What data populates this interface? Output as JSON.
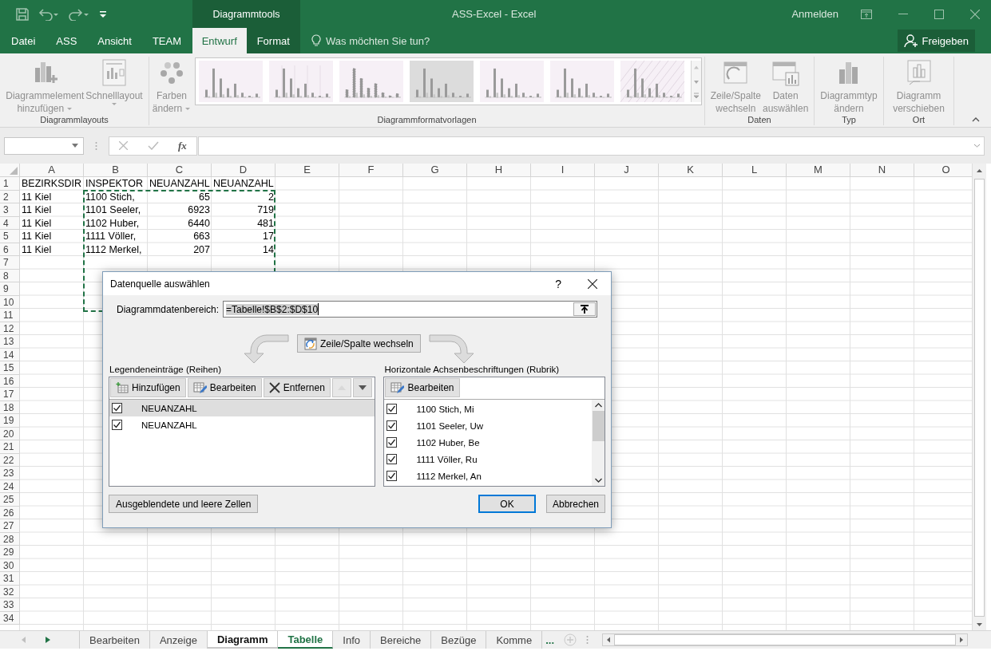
{
  "titlebar": {
    "context_header": "Diagrammtools",
    "title": "ASS-Excel - Excel",
    "sign_in": "Anmelden"
  },
  "tabs": [
    {
      "label": "Datei",
      "kind": "main",
      "selected": false
    },
    {
      "label": "ASS",
      "kind": "main",
      "selected": false
    },
    {
      "label": "Ansicht",
      "kind": "main",
      "selected": false
    },
    {
      "label": "TEAM",
      "kind": "main",
      "selected": false
    },
    {
      "label": "Entwurf",
      "kind": "context",
      "selected": true
    },
    {
      "label": "Format",
      "kind": "context",
      "selected": false
    }
  ],
  "tell_me": "Was möchten Sie tun?",
  "share_button": "Freigeben",
  "ribbon": {
    "groups": [
      {
        "label": "Diagrammlayouts",
        "items": [
          {
            "kind": "element",
            "lines": [
              "Diagrammelement",
              "hinzufügen"
            ],
            "dropdown": true
          },
          {
            "kind": "layout",
            "lines": [
              "Schnelllayout"
            ],
            "dropdown": true
          }
        ]
      },
      {
        "label": "Diagrammformatvorlagen",
        "items": [
          {
            "kind": "colors",
            "lines": [
              "Farben",
              "ändern"
            ],
            "dropdown": true
          },
          {
            "kind": "gallery",
            "styles": [
              {
                "kind": "plain"
              },
              {
                "kind": "grid"
              },
              {
                "kind": "dashed"
              },
              {
                "kind": "shaded"
              },
              {
                "kind": "plain"
              },
              {
                "kind": "plain"
              },
              {
                "kind": "hatched"
              }
            ]
          }
        ]
      },
      {
        "label": "Daten",
        "items": [
          {
            "kind": "switch",
            "lines": [
              "Zeile/Spalte",
              "wechseln"
            ],
            "dropdown": false
          },
          {
            "kind": "data",
            "lines": [
              "Daten",
              "auswählen"
            ],
            "dropdown": false
          }
        ]
      },
      {
        "label": "Typ",
        "items": [
          {
            "kind": "type",
            "lines": [
              "Diagrammtyp",
              "ändern"
            ],
            "dropdown": false
          }
        ]
      },
      {
        "label": "Ort",
        "items": [
          {
            "kind": "move",
            "lines": [
              "Diagramm",
              "verschieben"
            ],
            "dropdown": false
          }
        ]
      }
    ]
  },
  "formula_bar": {
    "fx": "fx"
  },
  "sheet": {
    "columns": [
      "A",
      "B",
      "C",
      "D",
      "E",
      "F",
      "G",
      "H",
      "I",
      "J",
      "K",
      "L",
      "M",
      "N",
      "O"
    ],
    "rows": [
      {
        "number": "1",
        "cells": [
          {
            "text": "BEZIRKSDIR",
            "kind": "text"
          },
          {
            "text": "INSPEKTOR",
            "kind": "text"
          },
          {
            "text": "NEUANZAHL",
            "kind": "text"
          },
          {
            "text": "NEUANZAHL",
            "kind": "text"
          }
        ]
      },
      {
        "number": "2",
        "cells": [
          {
            "text": "11 Kiel",
            "kind": "text"
          },
          {
            "text": "1100 Stich,",
            "kind": "text"
          },
          {
            "text": "65",
            "kind": "number"
          },
          {
            "text": "2",
            "kind": "number"
          }
        ]
      },
      {
        "number": "3",
        "cells": [
          {
            "text": "11 Kiel",
            "kind": "text"
          },
          {
            "text": "1101 Seeler,",
            "kind": "text"
          },
          {
            "text": "6923",
            "kind": "number"
          },
          {
            "text": "719",
            "kind": "number"
          }
        ]
      },
      {
        "number": "4",
        "cells": [
          {
            "text": "11 Kiel",
            "kind": "text"
          },
          {
            "text": "1102 Huber,",
            "kind": "text"
          },
          {
            "text": "6440",
            "kind": "number"
          },
          {
            "text": "481",
            "kind": "number"
          }
        ]
      },
      {
        "number": "5",
        "cells": [
          {
            "text": "11 Kiel",
            "kind": "text"
          },
          {
            "text": "1111 Völler,",
            "kind": "text"
          },
          {
            "text": "663",
            "kind": "number"
          },
          {
            "text": "17",
            "kind": "number"
          }
        ]
      },
      {
        "number": "6",
        "cells": [
          {
            "text": "11 Kiel",
            "kind": "text"
          },
          {
            "text": "1112 Merkel,",
            "kind": "text"
          },
          {
            "text": "207",
            "kind": "number"
          },
          {
            "text": "14",
            "kind": "number"
          }
        ]
      },
      {
        "number": "7"
      },
      {
        "number": "8"
      },
      {
        "number": "9"
      },
      {
        "number": "10"
      },
      {
        "number": "11"
      },
      {
        "number": "12"
      },
      {
        "number": "13"
      },
      {
        "number": "14"
      },
      {
        "number": "15"
      },
      {
        "number": "16"
      },
      {
        "number": "17"
      },
      {
        "number": "18"
      },
      {
        "number": "19"
      },
      {
        "number": "20"
      },
      {
        "number": "21"
      },
      {
        "number": "22"
      },
      {
        "number": "23"
      },
      {
        "number": "24"
      },
      {
        "number": "25"
      },
      {
        "number": "26"
      },
      {
        "number": "27"
      },
      {
        "number": "28"
      },
      {
        "number": "29"
      },
      {
        "number": "30"
      },
      {
        "number": "31"
      },
      {
        "number": "32"
      },
      {
        "number": "33"
      },
      {
        "number": "34"
      }
    ]
  },
  "sheet_tabs": [
    {
      "label": "Bearbeiten",
      "selected": false,
      "grouped": false
    },
    {
      "label": "Anzeige",
      "selected": false,
      "grouped": false
    },
    {
      "label": "Diagramm",
      "selected": false,
      "grouped": true
    },
    {
      "label": "Tabelle",
      "selected": true,
      "grouped": true
    },
    {
      "label": "Info",
      "selected": false,
      "grouped": false
    },
    {
      "label": "Bereiche",
      "selected": false,
      "grouped": false
    },
    {
      "label": "Bezüge",
      "selected": false,
      "grouped": false
    },
    {
      "label": "Komme",
      "selected": false,
      "grouped": false
    }
  ],
  "more_tabs": "...",
  "dialog": {
    "title": "Datenquelle auswählen",
    "help": "?",
    "range": {
      "label": "Diagrammdatenbereich:",
      "value": "=Tabelle!$B$2:$D$10",
      "text_selected": true
    },
    "switch_button": "Zeile/Spalte wechseln",
    "legend": {
      "title": "Legendeneinträge (Reihen)",
      "buttons": [
        {
          "kind": "add",
          "label": "Hinzufügen",
          "disabled": false
        },
        {
          "kind": "edit",
          "label": "Bearbeiten",
          "disabled": false
        },
        {
          "kind": "remove",
          "label": "Entfernen",
          "disabled": false
        },
        {
          "kind": "up",
          "disabled": true
        },
        {
          "kind": "down",
          "disabled": false
        }
      ],
      "series": [
        {
          "name": "NEUANZAHL",
          "checked": true,
          "selected": true
        },
        {
          "name": "NEUANZAHL",
          "checked": true,
          "selected": false
        }
      ]
    },
    "axis": {
      "title": "Horizontale Achsenbeschriftungen (Rubrik)",
      "buttons": [
        {
          "kind": "edit",
          "label": "Bearbeiten",
          "disabled": false
        }
      ],
      "categories": [
        {
          "name": "1100 Stich, Mi",
          "checked": true,
          "selected": false
        },
        {
          "name": "1101 Seeler, Uw",
          "checked": true,
          "selected": false
        },
        {
          "name": "1102 Huber, Be",
          "checked": true,
          "selected": false
        },
        {
          "name": "1111 Völler, Ru",
          "checked": true,
          "selected": false
        },
        {
          "name": "1112 Merkel, An",
          "checked": true,
          "selected": false
        }
      ]
    },
    "hidden_cells_button": "Ausgeblendete und leere Zellen",
    "ok_button": {
      "label": "OK",
      "default": true
    },
    "cancel_button": "Abbrechen"
  }
}
